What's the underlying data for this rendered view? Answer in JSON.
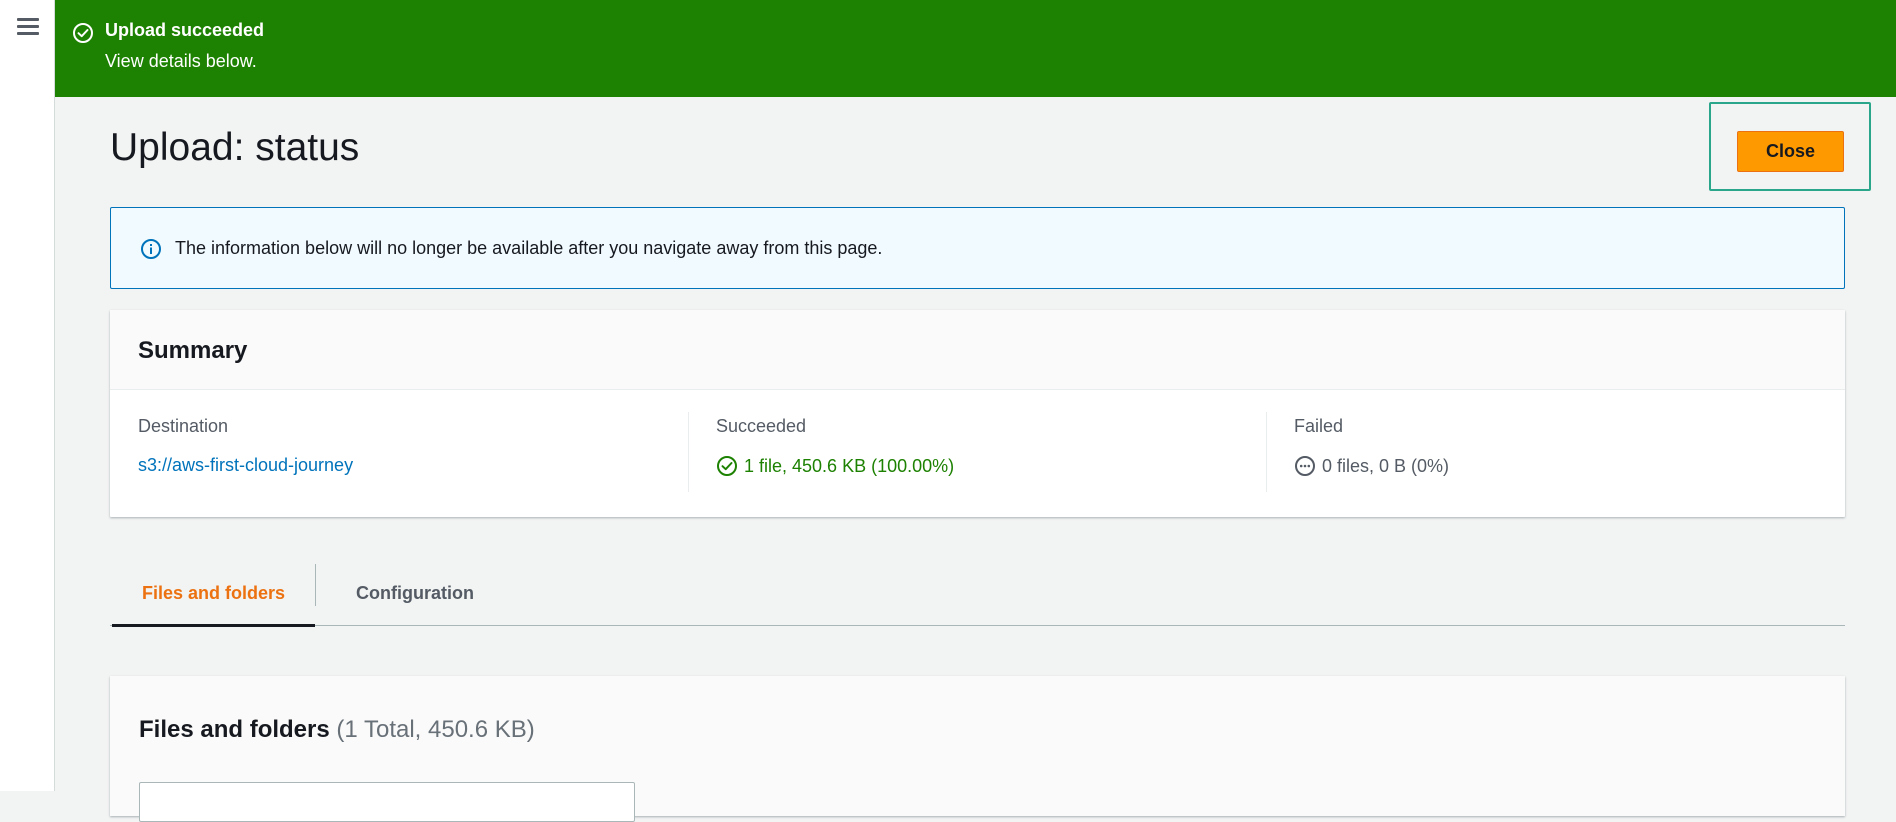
{
  "nav": {
    "menu_icon": "hamburger-icon"
  },
  "flash": {
    "title": "Upload succeeded",
    "subtitle": "View details below.",
    "icon": "check-circle-icon",
    "color": "#1d8102"
  },
  "header": {
    "title": "Upload: status",
    "close_label": "Close"
  },
  "info": {
    "icon": "info-circle-icon",
    "text": "The information below will no longer be available after you navigate away from this page."
  },
  "summary": {
    "title": "Summary",
    "destination": {
      "label": "Destination",
      "value": "s3://aws-first-cloud-journey"
    },
    "succeeded": {
      "label": "Succeeded",
      "value": "1 file, 450.6 KB (100.00%)",
      "icon": "check-circle-icon",
      "color": "#1d8102"
    },
    "failed": {
      "label": "Failed",
      "value": "0 files, 0 B (0%)",
      "icon": "ellipsis-circle-icon"
    }
  },
  "tabs": [
    {
      "label": "Files and folders",
      "active": true
    },
    {
      "label": "Configuration",
      "active": false
    }
  ],
  "files": {
    "title": "Files and folders",
    "count": "(1 Total, 450.6 KB)"
  },
  "colors": {
    "accent": "#ec7211",
    "button": "#ff9900",
    "link": "#0073bb"
  }
}
